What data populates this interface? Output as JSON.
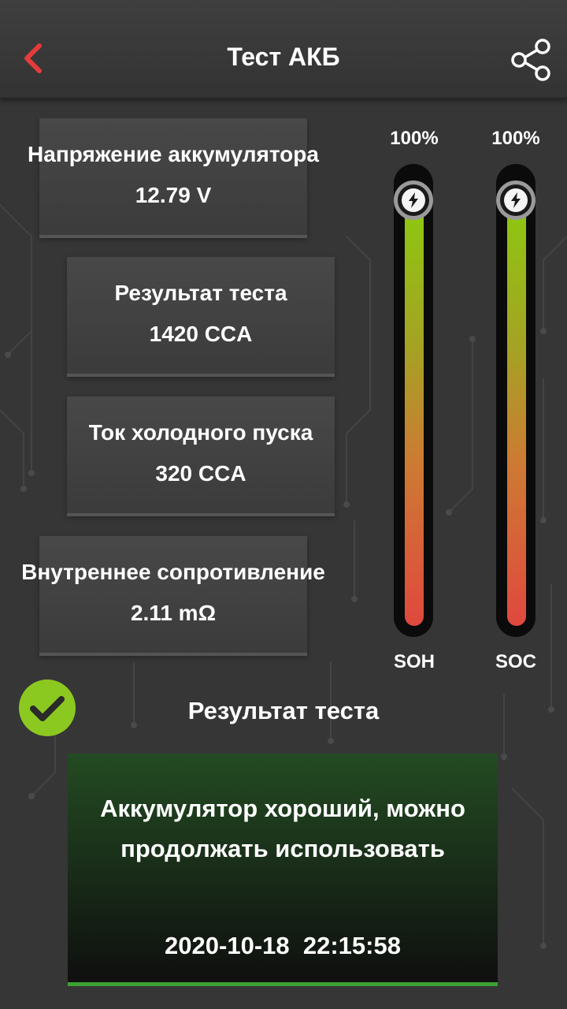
{
  "header": {
    "title": "Тест АКБ",
    "back_icon": "chevron-left-icon",
    "share_icon": "share-icon"
  },
  "cards": [
    {
      "label": "Напряжение аккумулятора",
      "value": "12.79 V"
    },
    {
      "label": "Результат теста",
      "value": "1420 CCA"
    },
    {
      "label": "Ток холодного пуска",
      "value": "320 CCA"
    },
    {
      "label": "Внутреннее сопротивление",
      "value": "2.11 mΩ"
    }
  ],
  "gauges": [
    {
      "label": "SOH",
      "percent_text": "100%",
      "level": 1.0
    },
    {
      "label": "SOC",
      "percent_text": "100%",
      "level": 1.0
    }
  ],
  "result": {
    "heading": "Результат теста",
    "message": "Аккумулятор хороший, можно продолжать использовать",
    "timestamp": "2020-10-18  22:15:58",
    "status_icon": "check-circle-icon"
  },
  "colors": {
    "accent_back": "#e43b3b",
    "good_green": "#8cc920",
    "gauge_top": "#8cc90e",
    "gauge_bottom": "#e0483e"
  }
}
